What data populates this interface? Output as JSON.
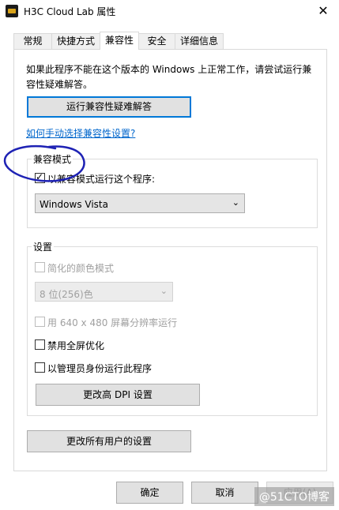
{
  "window": {
    "title": "H3C Cloud Lab 属性",
    "close_symbol": "✕"
  },
  "tabs": [
    {
      "label": "常规"
    },
    {
      "label": "快捷方式"
    },
    {
      "label": "兼容性"
    },
    {
      "label": "安全"
    },
    {
      "label": "详细信息"
    }
  ],
  "compat": {
    "intro": "如果此程序不能在这个版本的 Windows 上正常工作，请尝试运行兼容性疑难解答。",
    "troubleshoot_button": "运行兼容性疑难解答",
    "manual_link": "如何手动选择兼容性设置?"
  },
  "compat_mode": {
    "group_title": "兼容模式",
    "checkbox_label": "以兼容模式运行这个程序:",
    "os_selected": "Windows Vista",
    "chevron": "⌄"
  },
  "settings": {
    "group_title": "设置",
    "reduced_color_label": "简化的颜色模式",
    "color_selected": "8 位(256)色",
    "chevron": "⌄",
    "res_640_label": "用 640 x 480 屏幕分辨率运行",
    "disable_fullscreen_label": "禁用全屏优化",
    "run_as_admin_label": "以管理员身份运行此程序",
    "dpi_button": "更改高 DPI 设置"
  },
  "change_all_users_button": "更改所有用户的设置",
  "footer": {
    "ok": "确定",
    "cancel": "取消",
    "apply": "应用(A)"
  },
  "watermark": "@51CTO博客"
}
